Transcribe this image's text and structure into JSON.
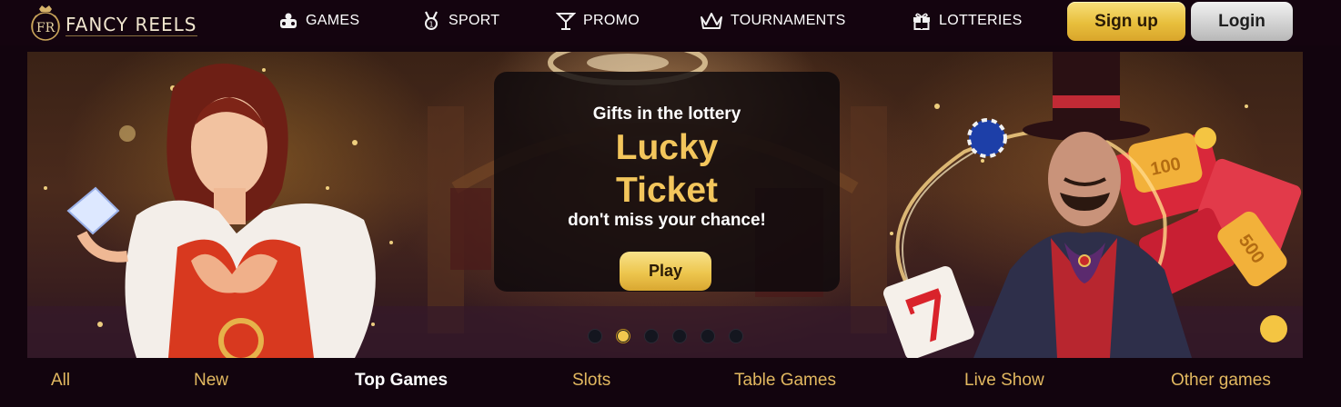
{
  "brand": {
    "name": "FANCY REELS",
    "logo_letters": "FR"
  },
  "nav": [
    {
      "label": "GAMES",
      "icon": "cards-icon"
    },
    {
      "label": "SPORT",
      "icon": "medal-icon"
    },
    {
      "label": "PROMO",
      "icon": "cocktail-icon"
    },
    {
      "label": "TOURNAMENTS",
      "icon": "crown-icon"
    },
    {
      "label": "LOTTERIES",
      "icon": "gift-icon"
    }
  ],
  "auth": {
    "signup_label": "Sign up",
    "login_label": "Login"
  },
  "banner": {
    "subtitle": "Gifts in the lottery",
    "title": "Lucky Ticket",
    "tagline": "don't miss your chance!",
    "cta_label": "Play",
    "slide_count": 6,
    "active_slide": 2,
    "ticket_values": [
      "100",
      "500"
    ],
    "slot_symbol": "7"
  },
  "categories": [
    {
      "label": "All",
      "active": false
    },
    {
      "label": "New",
      "active": false
    },
    {
      "label": "Top Games",
      "active": true
    },
    {
      "label": "Slots",
      "active": false
    },
    {
      "label": "Table Games",
      "active": false
    },
    {
      "label": "Live Show",
      "active": false
    },
    {
      "label": "Other games",
      "active": false
    }
  ],
  "colors": {
    "accent_gold": "#f3c65c",
    "background": "#12040e",
    "category_text": "#e2b860"
  }
}
